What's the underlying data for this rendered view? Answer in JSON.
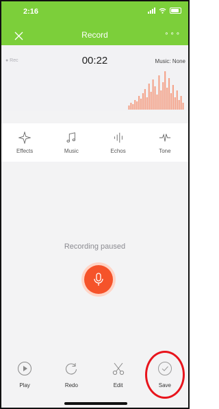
{
  "status_bar": {
    "time": "2:16"
  },
  "nav": {
    "title": "Record",
    "more": "∘∘∘"
  },
  "recorder": {
    "indicator": "● Rec",
    "timer": "00:22",
    "music_label": "Music: None",
    "status_text": "Recording paused"
  },
  "effects": [
    {
      "label": "Effects",
      "icon": "sparkle-icon"
    },
    {
      "label": "Music",
      "icon": "music-note-icon"
    },
    {
      "label": "Echos",
      "icon": "echo-icon"
    },
    {
      "label": "Tone",
      "icon": "tone-icon"
    }
  ],
  "bottom_actions": [
    {
      "label": "Play",
      "icon": "play-icon"
    },
    {
      "label": "Redo",
      "icon": "redo-icon"
    },
    {
      "label": "Edit",
      "icon": "scissors-icon"
    },
    {
      "label": "Save",
      "icon": "checkmark-icon"
    }
  ],
  "colors": {
    "accent_green": "#7ccf3a",
    "record_orange": "#f5532a",
    "waveform": "#f4a38a",
    "highlight_red": "#e8141c"
  }
}
